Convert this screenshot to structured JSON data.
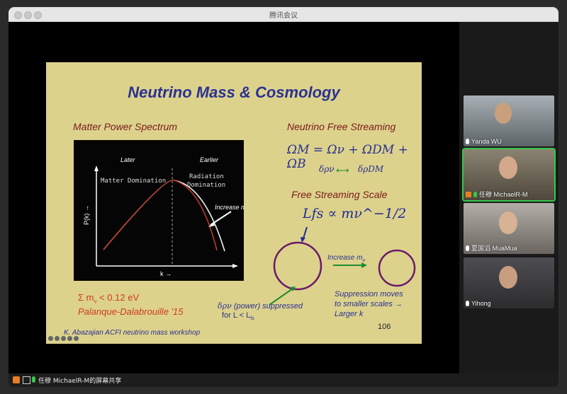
{
  "window": {
    "title": "腾讯会议"
  },
  "slide": {
    "title": "Neutrino Mass & Cosmology",
    "left_heading": "Matter Power Spectrum",
    "right_heading": "Neutrino Free Streaming",
    "plot": {
      "label_later": "Later",
      "label_earlier": "Earlier",
      "label_matter": "Matter Domination",
      "label_radiation_1": "Radiation",
      "label_radiation_2": "Domination",
      "ylabel": "P(k) →",
      "xlabel": "k →",
      "annotation": "Increase m",
      "annotation_sub": "ν"
    },
    "omega_eq": "ΩM = Ων + ΩDM + ΩB",
    "delta_left": "δρν",
    "delta_right": "δρDM",
    "fs_scale": "Free Streaming Scale",
    "lfs_eq": "Lfs ∝ mν^−1/2",
    "increase_label": "Increase m",
    "increase_sub": "ν",
    "sum_mass": "Σ m",
    "sum_mass_sub": "ν",
    "sum_mass_val": " < 0.12 eV",
    "citation": "Palanque-Dalabrouille '15",
    "suppressed_1": " (power) suppressed",
    "suppressed_2": "for L < L",
    "suppressed_2_sub": "fs",
    "suppression_moves_1": "Suppression moves",
    "suppression_moves_2": "to smaller scales →",
    "suppression_moves_3": "Larger k",
    "page_number": "106",
    "credit": "K. Abazajian ACFI neutrino mass workshop"
  },
  "participants": [
    {
      "name": "Yanda WU",
      "active": false,
      "bg": "#8a8f93"
    },
    {
      "name": "任穆 MichaelR-M",
      "active": true,
      "bg": "#6e6555"
    },
    {
      "name": "夏国滔 MuaMua",
      "active": false,
      "bg": "#8f8b86"
    },
    {
      "name": "Yihong",
      "active": false,
      "bg": "#3d3d3f"
    }
  ],
  "statusbar": {
    "text": "任穆 MichaelR-M的屏幕共享"
  },
  "colors": {
    "accent_green": "#35c84a",
    "slide_bg": "#dcd28c",
    "slide_blue": "#2b3192",
    "slide_red": "#7a1a1a"
  }
}
